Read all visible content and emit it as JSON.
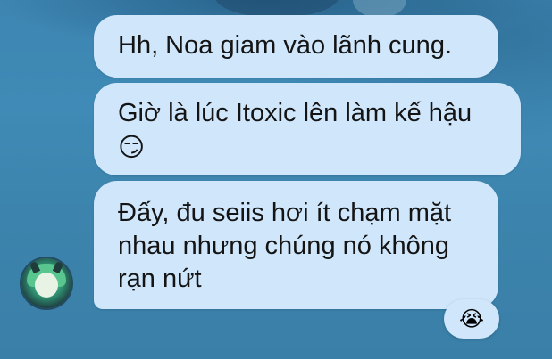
{
  "messages": [
    {
      "lines": [
        "Hh, Noa giam vào lãnh cung."
      ]
    },
    {
      "lines": [
        "Giờ là lúc Itoxic lên làm kế hậu"
      ],
      "emoji": "😏"
    },
    {
      "lines": [
        "Đấy, đu seiis hơi ít chạm mặt",
        "nhau nhưng chúng nó không",
        "rạn nứt"
      ]
    }
  ],
  "reaction": {
    "emoji": "😭"
  },
  "avatar_icon": "anime-girl-avatar-icon",
  "colors": {
    "bubble": "#cfe6fb",
    "background": "#3f89b5"
  }
}
